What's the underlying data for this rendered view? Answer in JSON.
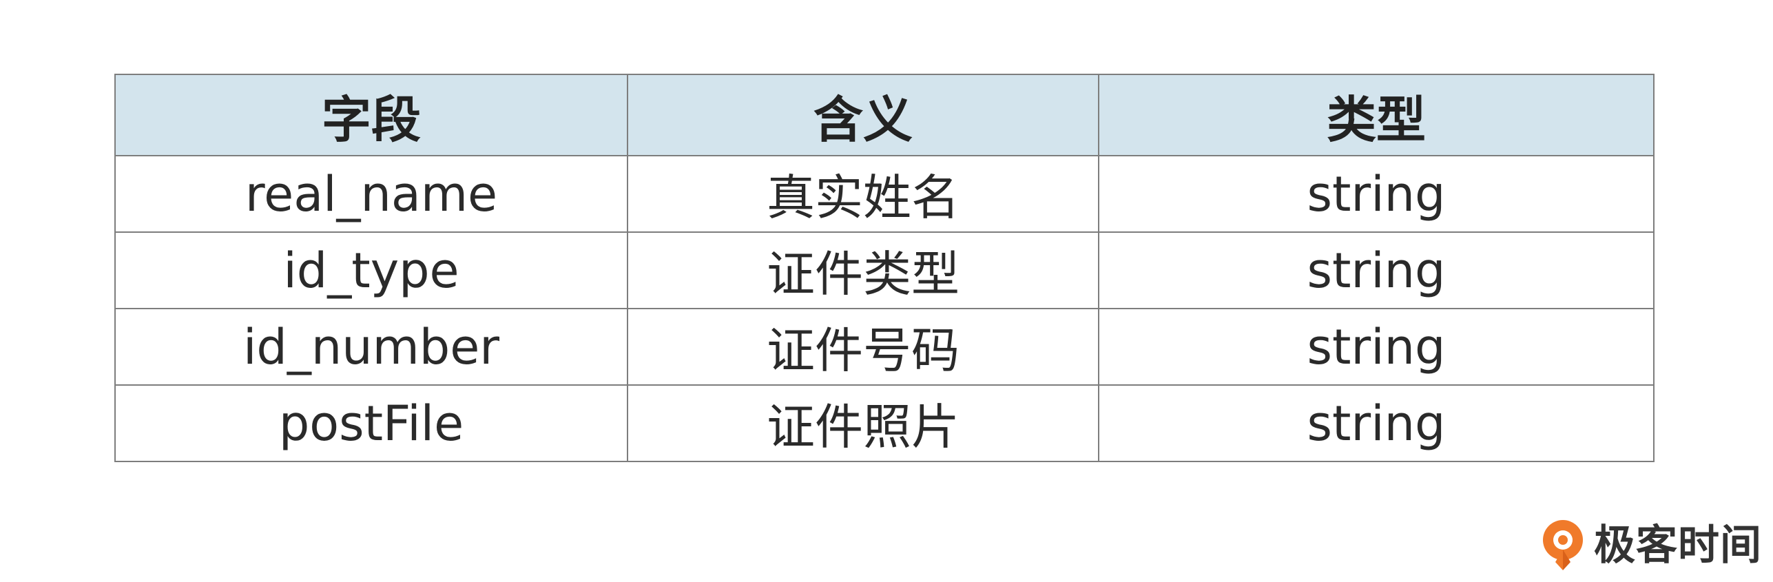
{
  "table": {
    "headers": [
      "字段",
      "含义",
      "类型"
    ],
    "rows": [
      [
        "real_name",
        "真实姓名",
        "string"
      ],
      [
        "id_type",
        "证件类型",
        "string"
      ],
      [
        "id_number",
        "证件号码",
        "string"
      ],
      [
        "postFile",
        "证件照片",
        "string"
      ]
    ]
  },
  "logo": {
    "text": "极客时间",
    "icon": "geektime-logo-icon",
    "color": "#f07a2a"
  },
  "colors": {
    "header_bg": "#d3e4ed",
    "border": "#7d7d7d",
    "text": "#2a2a2a"
  }
}
